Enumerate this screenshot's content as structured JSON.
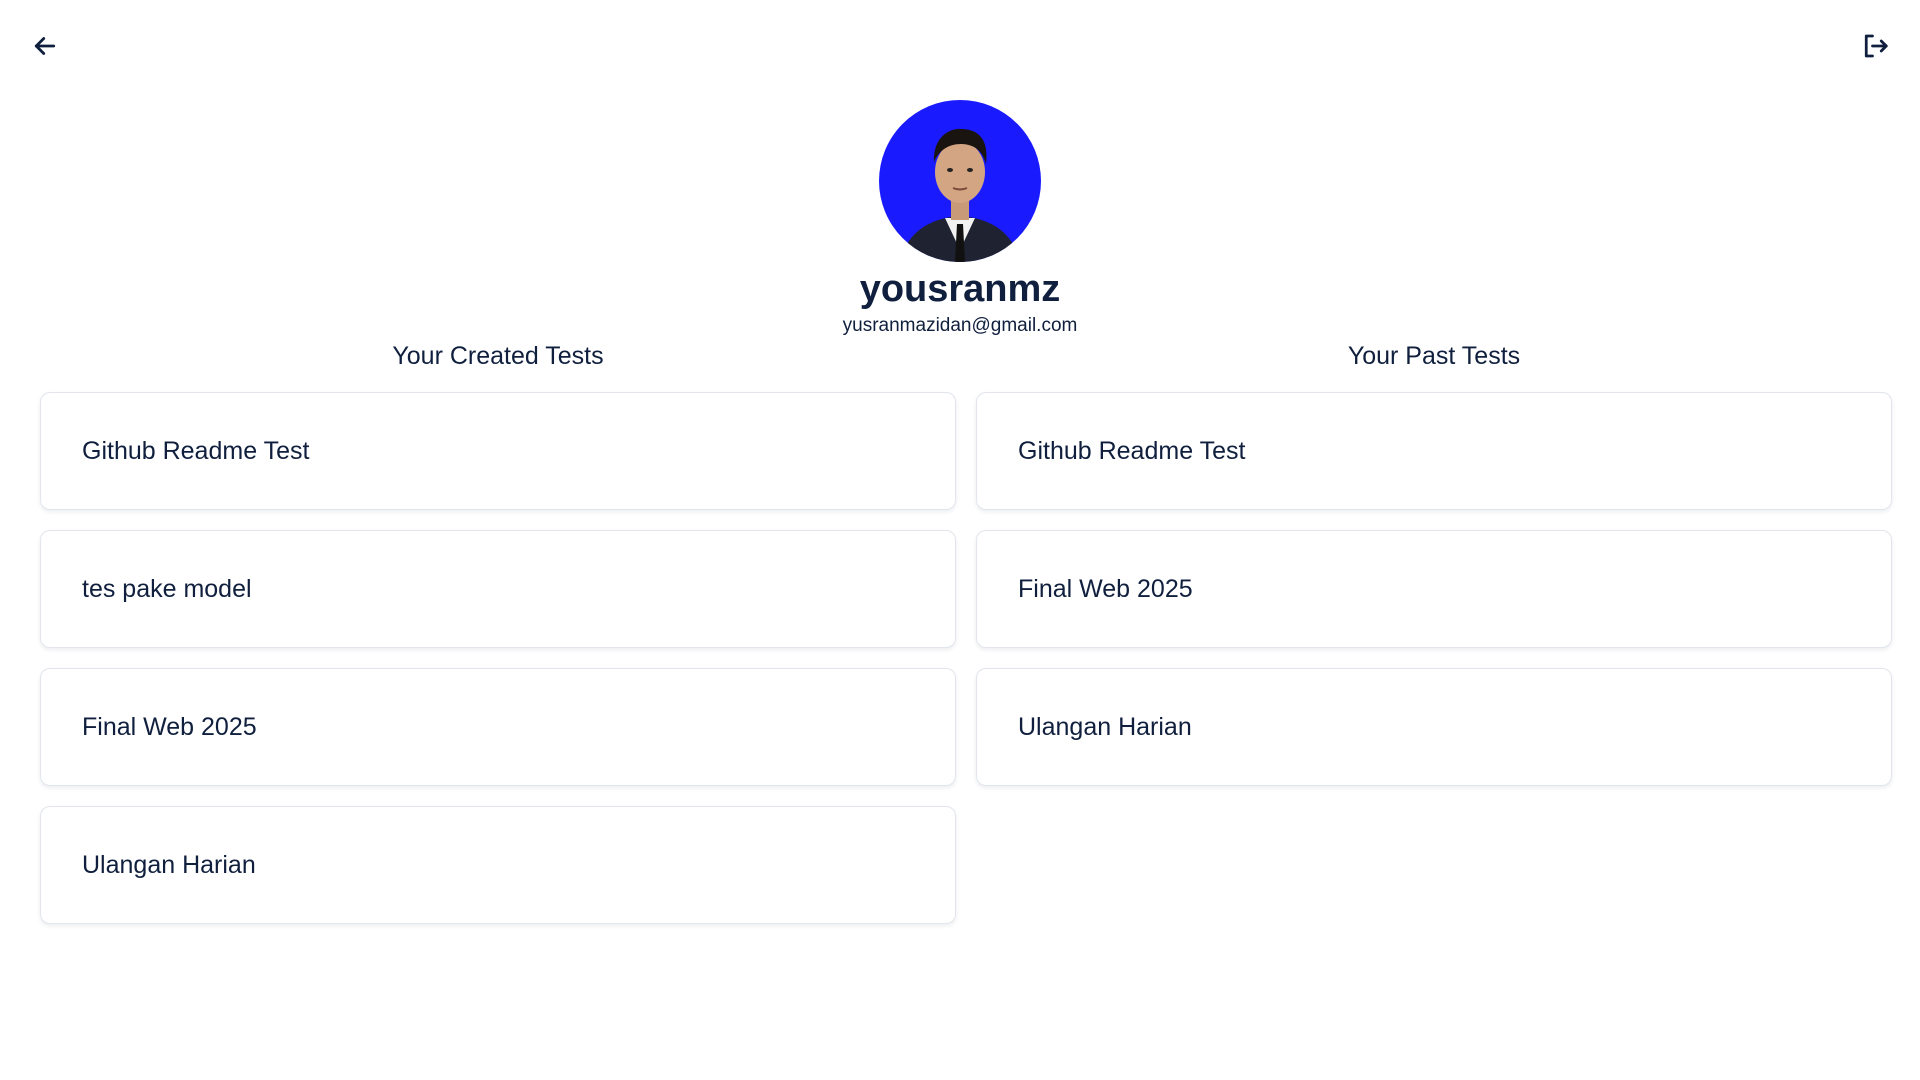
{
  "nav": {
    "back_icon": "arrow-left-icon",
    "logout_icon": "logout-icon"
  },
  "profile": {
    "username": "yousranmz",
    "email": "yusranmazidan@gmail.com",
    "avatar_background": "#1a1aff"
  },
  "created_tests": {
    "title": "Your Created Tests",
    "items": [
      {
        "label": "Github Readme Test"
      },
      {
        "label": "tes pake model"
      },
      {
        "label": "Final Web 2025"
      },
      {
        "label": "Ulangan Harian"
      }
    ]
  },
  "past_tests": {
    "title": "Your Past Tests",
    "items": [
      {
        "label": "Github Readme Test"
      },
      {
        "label": "Final Web 2025"
      },
      {
        "label": "Ulangan Harian"
      }
    ]
  },
  "colors": {
    "text": "#0f1f3d",
    "card_border": "#e2e6ec",
    "background": "#ffffff"
  }
}
